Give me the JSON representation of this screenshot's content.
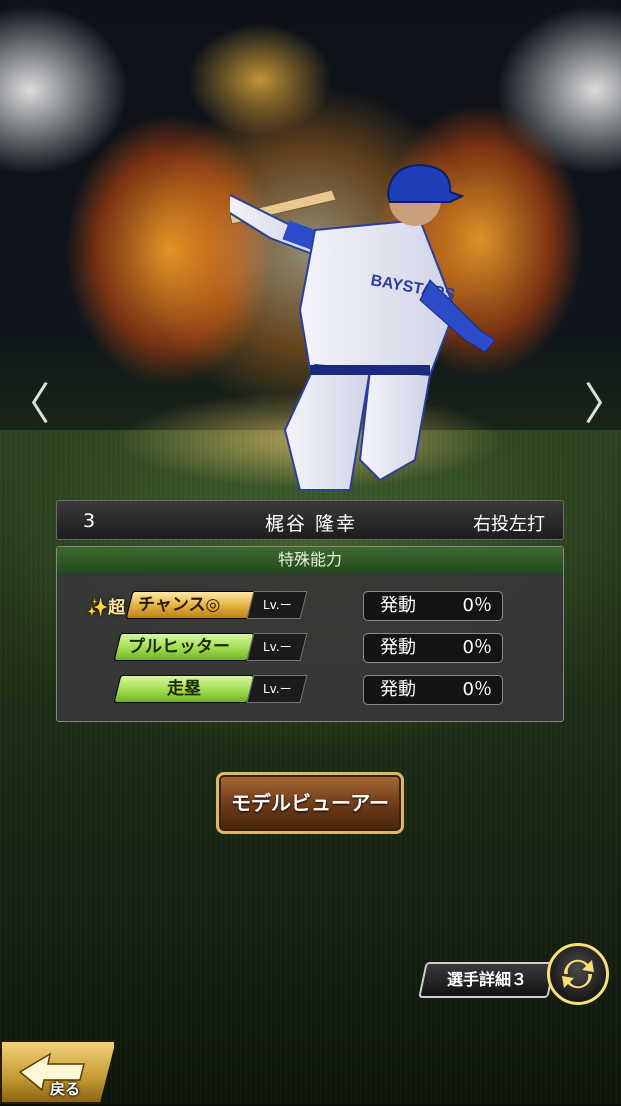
{
  "player": {
    "number": "3",
    "name": "梶谷 隆幸",
    "handedness": "右投左打",
    "jersey_text": "BAYSTARS"
  },
  "abilities": {
    "header": "特殊能力",
    "items": [
      {
        "prefix": "✨超",
        "label": "チャンス◎",
        "style": "gold",
        "level": "Lv.ー",
        "status_label": "発動",
        "percent": "0％"
      },
      {
        "prefix": "",
        "label": "プルヒッター",
        "style": "green",
        "level": "Lv.ー",
        "status_label": "発動",
        "percent": "0％"
      },
      {
        "prefix": "",
        "label": "走塁",
        "style": "green",
        "level": "Lv.ー",
        "status_label": "発動",
        "percent": "0％"
      }
    ]
  },
  "buttons": {
    "model_viewer": "モデルビューアー",
    "player_detail": "選手詳細３",
    "back": "戻る"
  },
  "nav": {
    "prev_icon": "chevron-left-icon",
    "next_icon": "chevron-right-icon",
    "prev_glyph": "〈",
    "next_glyph": "〉"
  },
  "colors": {
    "ability_gold": "#e2ae3c",
    "ability_green": "#9cd94a",
    "panel_header": "#3d6a2f",
    "button_brown": "#6b3a17",
    "accent_yellow": "#f5e07a"
  }
}
